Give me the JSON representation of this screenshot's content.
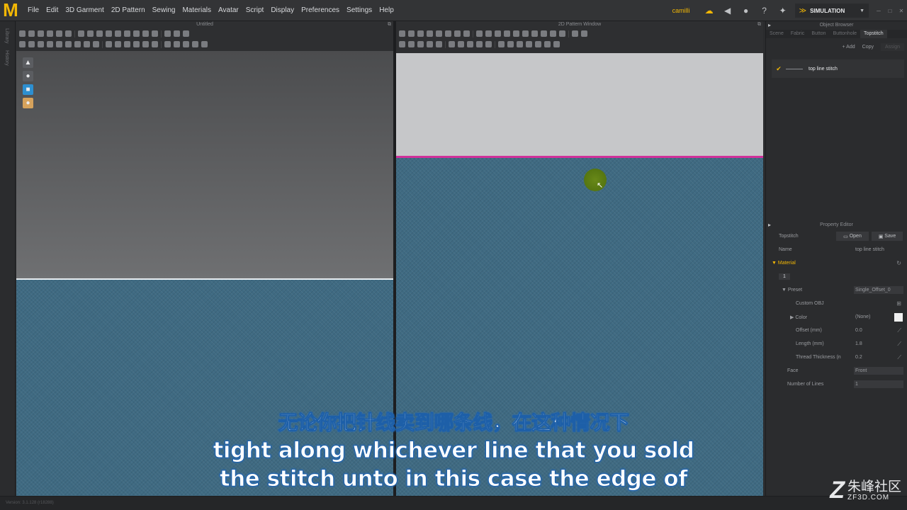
{
  "app": {
    "logo": "M"
  },
  "menu": [
    "File",
    "Edit",
    "3D Garment",
    "2D Pattern",
    "Sewing",
    "Materials",
    "Avatar",
    "Script",
    "Display",
    "Preferences",
    "Settings",
    "Help"
  ],
  "topbar": {
    "user_label": "camilli",
    "mode": "SIMULATION"
  },
  "library_tabs": [
    "Library",
    "History"
  ],
  "win3d": {
    "title": "Untitled"
  },
  "win2d": {
    "title": "2D Pattern Window"
  },
  "object_browser": {
    "title": "Object Browser",
    "tabs": [
      "Scene",
      "Fabric",
      "Button",
      "Buttonhole",
      "Topstitch"
    ],
    "active_tab": "Topstitch",
    "actions": {
      "add": "+ Add",
      "copy": "Copy",
      "assign": "Assign"
    },
    "items": [
      {
        "name": "top line stitch"
      }
    ]
  },
  "property_editor": {
    "title": "Property Editor",
    "header_label": "Topstitch",
    "open_label": "Open",
    "save_label": "Save",
    "name_key": "Name",
    "name_value": "top line stitch",
    "section_material": "Material",
    "material_index": "1",
    "preset_key": "Preset",
    "preset_value": "Single_Offset_0",
    "custom_obj_key": "Custom OBJ",
    "color_key": "Color",
    "color_value": "(None)",
    "offset_key": "Offset (mm)",
    "offset_value": "0.0",
    "length_key": "Length (mm)",
    "length_value": "1.8",
    "thickness_key": "Thread Thickness (n",
    "thickness_value": "0.2",
    "face_key": "Face",
    "face_value": "Front",
    "lines_key": "Number of Lines",
    "lines_value": "1"
  },
  "status": {
    "text": "Version: 3.1.128      (r18288)"
  },
  "subtitles": {
    "line_cn": "无论你把针线卖到哪条线，在这种情况下",
    "line_en1": "tight along whichever line that you sold",
    "line_en2": "the stitch unto in this case the edge of"
  },
  "watermark": {
    "cn": "朱峰社区",
    "en": "ZF3D.COM"
  },
  "colors": {
    "accent": "#f2b705",
    "fabric": "#3f6a82",
    "stitch_line": "#d0309a"
  }
}
